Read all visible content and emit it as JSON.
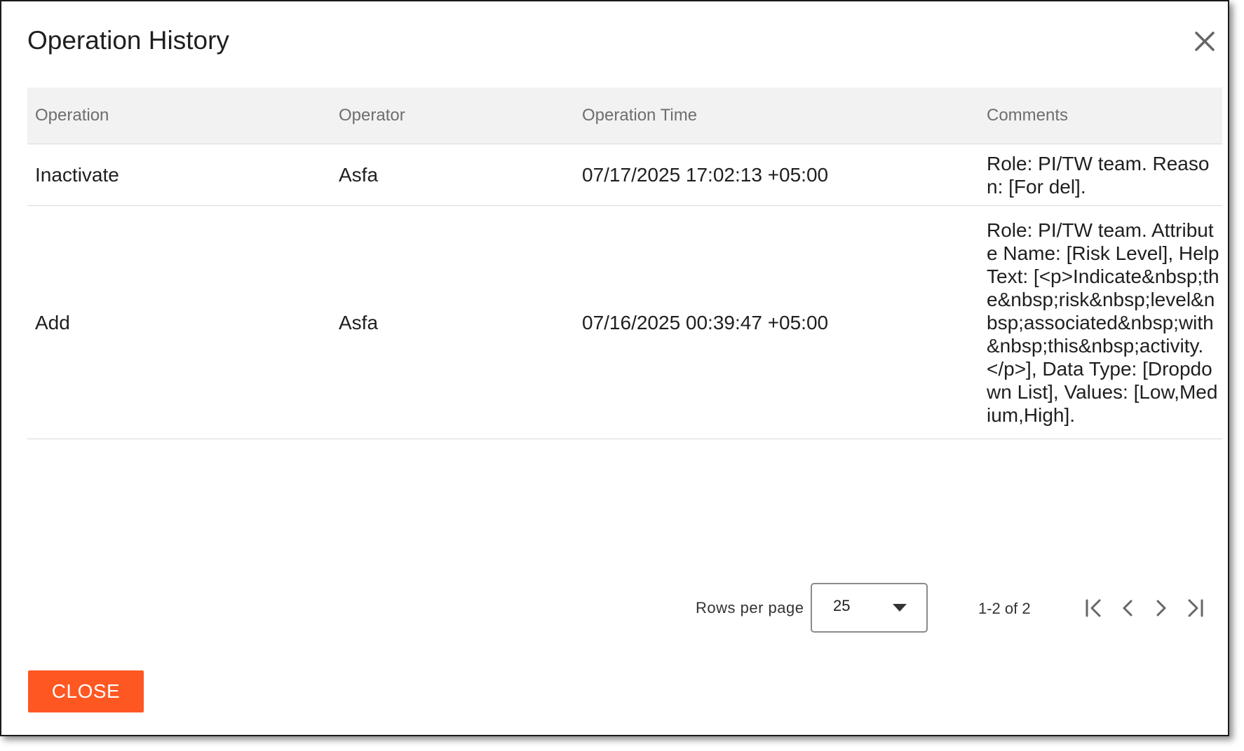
{
  "dialog": {
    "title": "Operation History",
    "close_icon": "close-icon"
  },
  "table": {
    "columns": [
      "Operation",
      "Operator",
      "Operation Time",
      "Comments"
    ],
    "rows": [
      {
        "operation": "Inactivate",
        "operator": "Asfa",
        "time": "07/17/2025 17:02:13 +05:00",
        "comments": "Role: PI/TW team. Reason: [For del]."
      },
      {
        "operation": "Add",
        "operator": "Asfa",
        "time": "07/16/2025 00:39:47 +05:00",
        "comments": "Role: PI/TW team. Attribute Name: [Risk Level], Help Text: [<p>Indicate&nbsp;the&nbsp;risk&nbsp;level&nbsp;associated&nbsp;with&nbsp;this&nbsp;activity.</p>], Data Type: [Dropdown List], Values: [Low,Medium,High]."
      }
    ]
  },
  "pagination": {
    "rows_per_page_label": "Rows per page",
    "rows_per_page_value": "25",
    "range_text": "1-2 of 2",
    "icons": [
      "first-page-icon",
      "previous-page-icon",
      "next-page-icon",
      "last-page-icon"
    ]
  },
  "footer": {
    "close_label": "CLOSE"
  },
  "colors": {
    "accent": "#ff5722",
    "header_bg": "#f2f2f2",
    "border": "#d9d9d9"
  }
}
